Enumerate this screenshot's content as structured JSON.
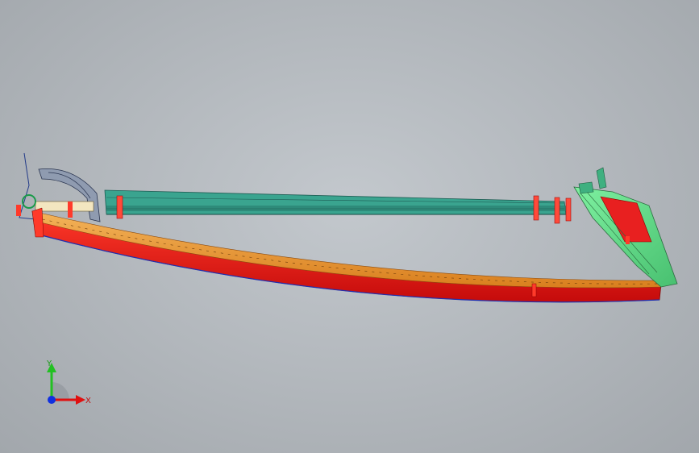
{
  "triad": {
    "x_label": "X",
    "y_label": "Y"
  },
  "colors": {
    "background": "#b7bcc1",
    "rail_bottom": "#e81515",
    "rail_top": "#e8942a",
    "upper_bar": "#2a8a7a",
    "front_body_green": "#66e08a",
    "front_body_red": "#e82020",
    "axis_x": "#e01010",
    "axis_y": "#20c020",
    "axis_z": "#1030e0"
  },
  "icons": {
    "triad": "coordinate-triad-icon"
  }
}
